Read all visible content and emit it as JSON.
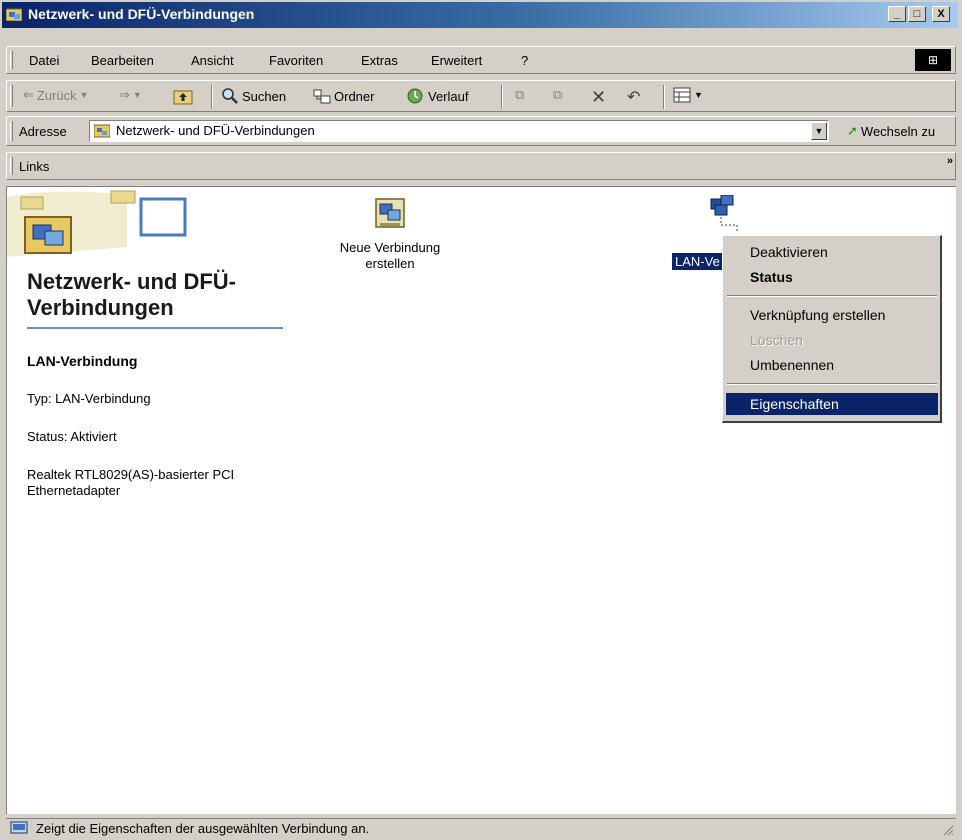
{
  "window": {
    "title": "Netzwerk- und DFÜ-Verbindungen",
    "minimize": "_",
    "maximize": "□",
    "close": "X"
  },
  "menu": {
    "items": [
      "Datei",
      "Bearbeiten",
      "Ansicht",
      "Favoriten",
      "Extras",
      "Erweitert",
      "?"
    ]
  },
  "toolbar": {
    "back": "Zurück",
    "search": "Suchen",
    "folders": "Ordner",
    "history": "Verlauf"
  },
  "address": {
    "label": "Adresse",
    "value": "Netzwerk- und DFÜ-Verbindungen",
    "go": "Wechseln zu"
  },
  "links": {
    "label": "Links",
    "chevron": "»"
  },
  "panel": {
    "title": "Netzwerk- und DFÜ-Verbindungen",
    "selected_name": "LAN-Verbindung",
    "type": "Typ: LAN-Verbindung",
    "status": "Status: Aktiviert",
    "adapter": "Realtek RTL8029(AS)-basierter PCI Ethernetadapter"
  },
  "icons": {
    "new_connection": "Neue Verbindung erstellen",
    "lan_label": "LAN-Ve"
  },
  "context_menu": {
    "items": [
      "Deaktivieren",
      "Status",
      "Verknüpfung erstellen",
      "Löschen",
      "Umbenennen",
      "Eigenschaften"
    ]
  },
  "statusbar": {
    "text": "Zeigt die Eigenschaften der ausgewählten Verbindung an."
  },
  "colors": {
    "titlebar_start": "#0a246a",
    "titlebar_end": "#a6caf0",
    "highlight": "#0a246a",
    "face": "#d4d0c8"
  }
}
